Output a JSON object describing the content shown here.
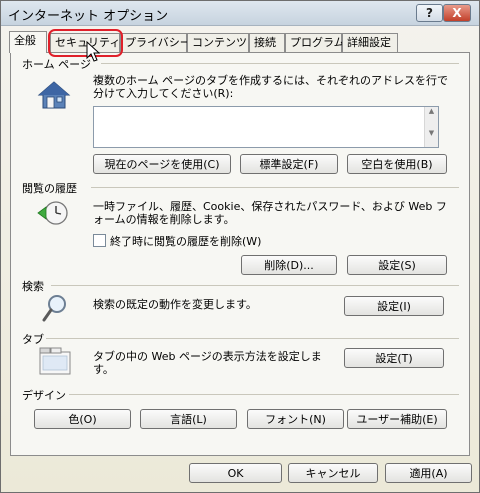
{
  "window": {
    "title": "インターネット オプション",
    "help_label": "?",
    "close_label": "X"
  },
  "tabs": [
    {
      "label": "全般",
      "active": true
    },
    {
      "label": "セキュリティ",
      "active": false
    },
    {
      "label": "プライバシー",
      "active": false
    },
    {
      "label": "コンテンツ",
      "active": false
    },
    {
      "label": "接続",
      "active": false
    },
    {
      "label": "プログラム",
      "active": false
    },
    {
      "label": "詳細設定",
      "active": false
    }
  ],
  "home": {
    "heading": "ホーム ページ",
    "description": "複数のホーム ページのタブを作成するには、それぞれのアドレスを行で分けて入力してください(R):",
    "url_value": "",
    "use_current_label": "現在のページを使用(C)",
    "use_default_label": "標準設定(F)",
    "use_blank_label": "空白を使用(B)"
  },
  "history": {
    "heading": "閲覧の履歴",
    "description": "一時ファイル、履歴、Cookie、保存されたパスワード、および Web フォームの情報を削除します。",
    "checkbox_label": "終了時に閲覧の履歴を削除(W)",
    "delete_label": "削除(D)...",
    "settings_label": "設定(S)"
  },
  "search": {
    "heading": "検索",
    "description": "検索の既定の動作を変更します。",
    "settings_label": "設定(I)"
  },
  "tabs_section": {
    "heading": "タブ",
    "description": "タブの中の Web ページの表示方法を設定します。",
    "settings_label": "設定(T)"
  },
  "design": {
    "heading": "デザイン",
    "colors_label": "色(O)",
    "languages_label": "言語(L)",
    "fonts_label": "フォント(N)",
    "accessibility_label": "ユーザー補助(E)"
  },
  "footer": {
    "ok_label": "OK",
    "cancel_label": "キャンセル",
    "apply_label": "適用(A)"
  },
  "colors": {
    "highlight": "#e0202a",
    "accent": "#3a6ea5"
  }
}
